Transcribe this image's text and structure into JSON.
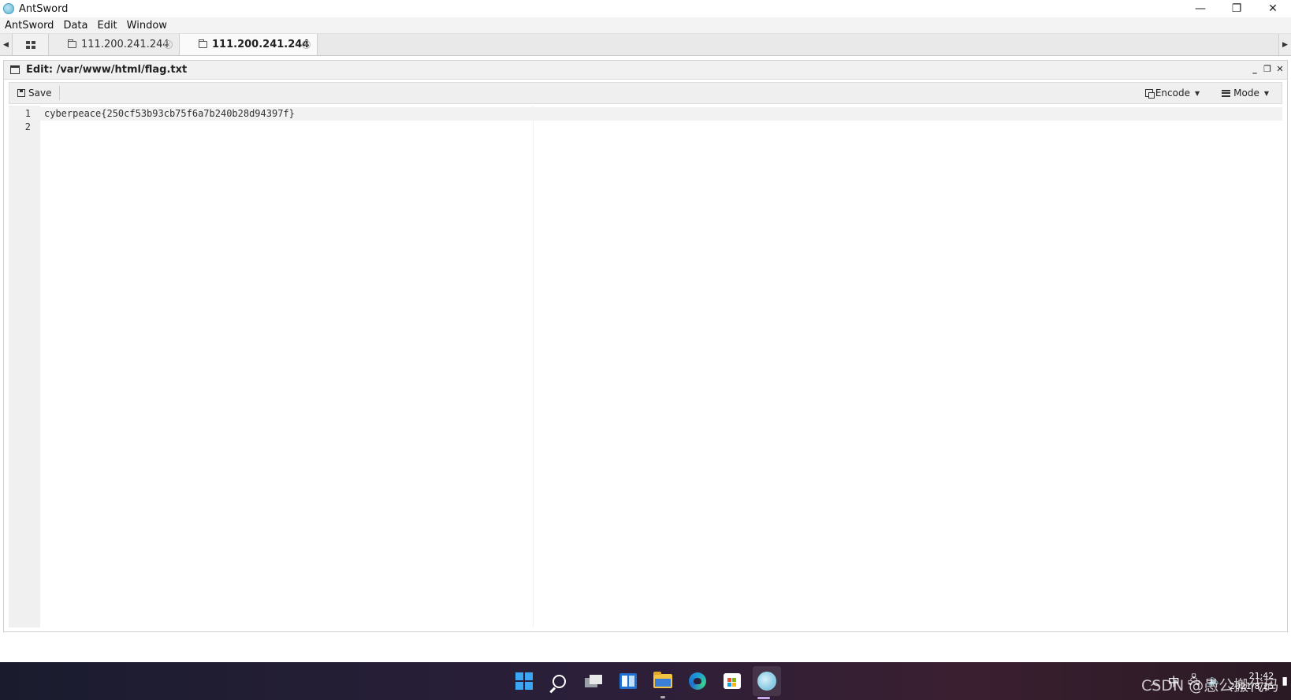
{
  "window": {
    "title": "AntSword",
    "minimize": "—",
    "restore": "❐",
    "close": "✕"
  },
  "menu": [
    "AntSword",
    "Data",
    "Edit",
    "Window"
  ],
  "tabs": [
    {
      "label": "111.200.241.244",
      "active": false
    },
    {
      "label": "111.200.241.244",
      "active": true
    }
  ],
  "editor_panel": {
    "title": "Edit: /var/www/html/flag.txt",
    "toolbar": {
      "save_label": "Save",
      "encode_label": "Encode",
      "mode_label": "Mode"
    },
    "lines": [
      {
        "number": "1",
        "text": "cyberpeace{250cf53b93cb75f6a7b240b28d94397f}"
      },
      {
        "number": "2",
        "text": ""
      }
    ]
  },
  "taskbar": {
    "apps": [
      "start-icon",
      "search-icon",
      "task-view-icon",
      "widgets-icon",
      "file-explorer-icon",
      "edge-icon",
      "store-icon",
      "antsword-icon"
    ],
    "tray": {
      "ime": "中",
      "time": "21:42",
      "date": "2021/8/25"
    },
    "watermark": "CSDN @愚公搬代码"
  },
  "colors": {
    "taskbar_start": "#1a1c2e",
    "taskbar_end": "#3a1f30",
    "windows_blue": "#3aa6f5"
  }
}
